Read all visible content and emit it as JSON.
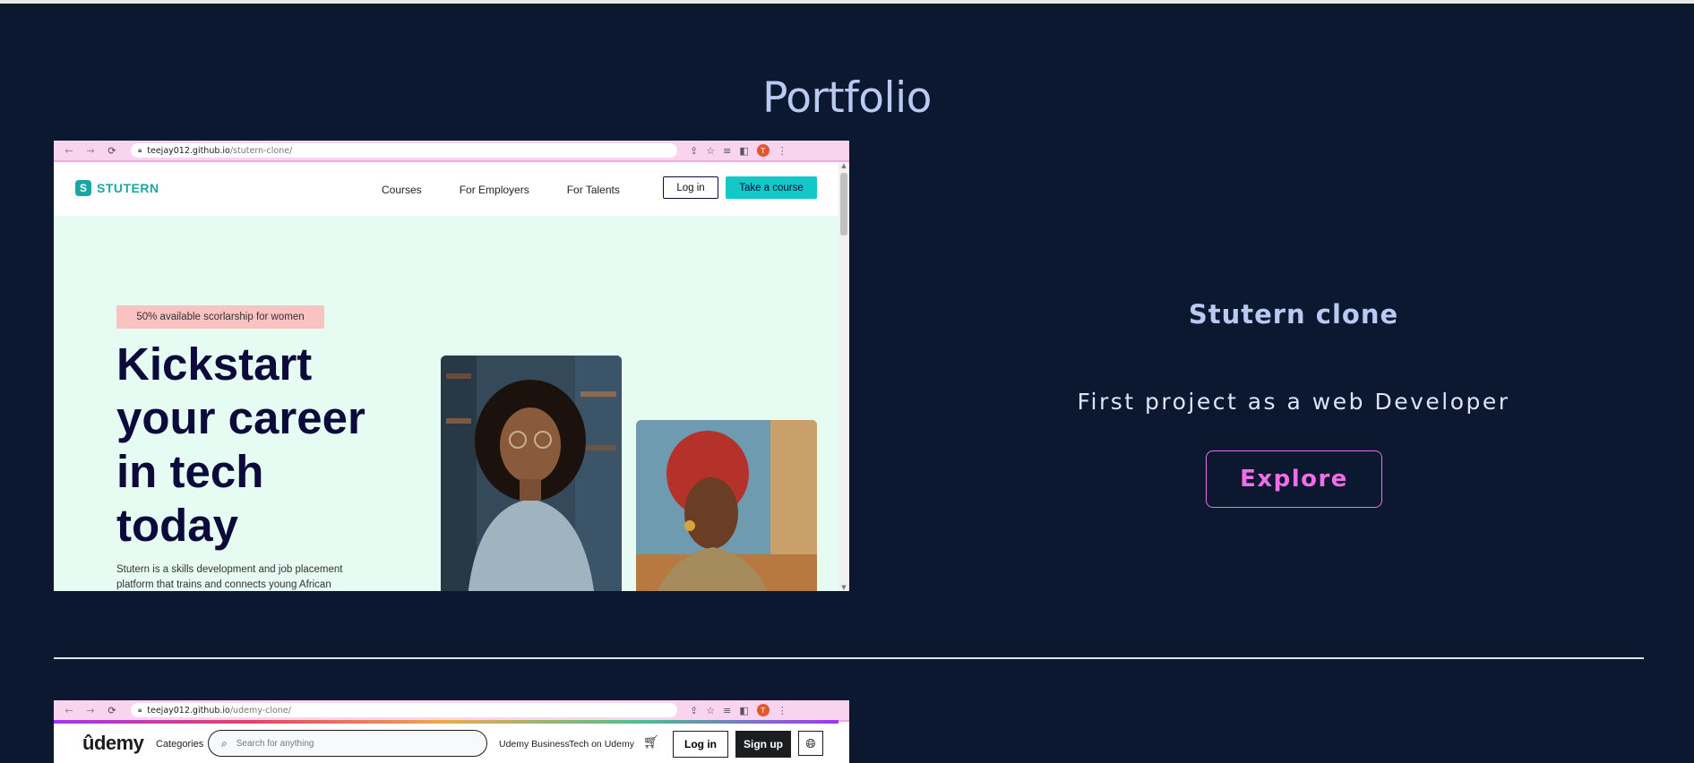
{
  "section": {
    "title": "Portfolio"
  },
  "projects": [
    {
      "title": "Stutern clone",
      "description": "First project as a web Developer",
      "cta": "Explore",
      "screenshot": {
        "url_host": "teejay012.github.io",
        "url_path": "/stutern-clone/",
        "site": {
          "logo_letter": "S",
          "logo_text": "STUTERN",
          "nav": [
            "Courses",
            "For Employers",
            "For Talents"
          ],
          "login": "Log in",
          "take_course": "Take a course",
          "badge": "50% available scorlarship for women",
          "headline": "Kickstart your career in tech today",
          "subtext": "Stutern is a skills development and job placement platform that trains and connects young African"
        }
      }
    },
    {
      "screenshot": {
        "url_host": "teejay012.github.io",
        "url_path": "/udemy-clone/",
        "site": {
          "logo": "ûdemy",
          "categories": "Categories",
          "search_placeholder": "Search for anything",
          "business": "Udemy Business",
          "teach": "Tech on Udemy",
          "login": "Log in",
          "signup": "Sign up"
        }
      }
    }
  ],
  "browser": {
    "avatar_letter": "T"
  },
  "colors": {
    "background": "#0c1830",
    "title": "#b9c9f1",
    "accent": "#f06ee6"
  }
}
